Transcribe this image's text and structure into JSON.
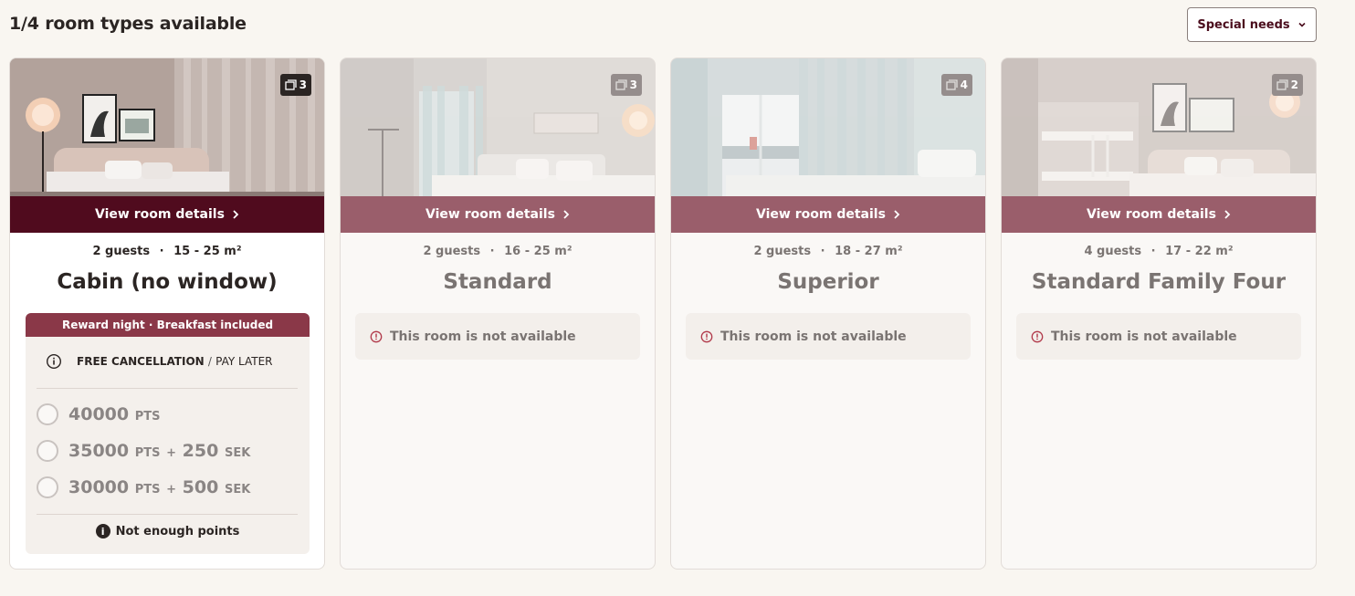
{
  "header": {
    "availability_text": "1/4 room types available",
    "special_needs_label": "Special needs"
  },
  "rooms": [
    {
      "photo_count": "3",
      "view_details_label": "View room details",
      "guests": "2 guests",
      "size": "15 - 25 m²",
      "name": "Cabin (no window)",
      "available": true,
      "rate": {
        "header": "Reward night · Breakfast included",
        "cancellation": "FREE CANCELLATION",
        "cancellation_sep": "/",
        "pay_later": "PAY LATER",
        "options": [
          {
            "points": "40000",
            "pts_unit": "PTS",
            "plus": "",
            "cash": "",
            "cash_unit": ""
          },
          {
            "points": "35000",
            "pts_unit": "PTS",
            "plus": "+",
            "cash": "250",
            "cash_unit": "SEK"
          },
          {
            "points": "30000",
            "pts_unit": "PTS",
            "plus": "+",
            "cash": "500",
            "cash_unit": "SEK"
          }
        ],
        "notice": "Not enough points"
      }
    },
    {
      "photo_count": "3",
      "view_details_label": "View room details",
      "guests": "2 guests",
      "size": "16 - 25 m²",
      "name": "Standard",
      "available": false,
      "unavailable_text": "This room is not available"
    },
    {
      "photo_count": "4",
      "view_details_label": "View room details",
      "guests": "2 guests",
      "size": "18 - 27 m²",
      "name": "Superior",
      "available": false,
      "unavailable_text": "This room is not available"
    },
    {
      "photo_count": "2",
      "view_details_label": "View room details",
      "guests": "4 guests",
      "size": "17 - 22 m²",
      "name": "Standard Family Four",
      "available": false,
      "unavailable_text": "This room is not available"
    }
  ],
  "meta_separator": "·",
  "colors": {
    "brand": "#500b1e",
    "brand_muted": "#9a5e6b",
    "rate_header": "#8a3848",
    "background": "#f9f6f1",
    "alert": "#b1394a"
  }
}
